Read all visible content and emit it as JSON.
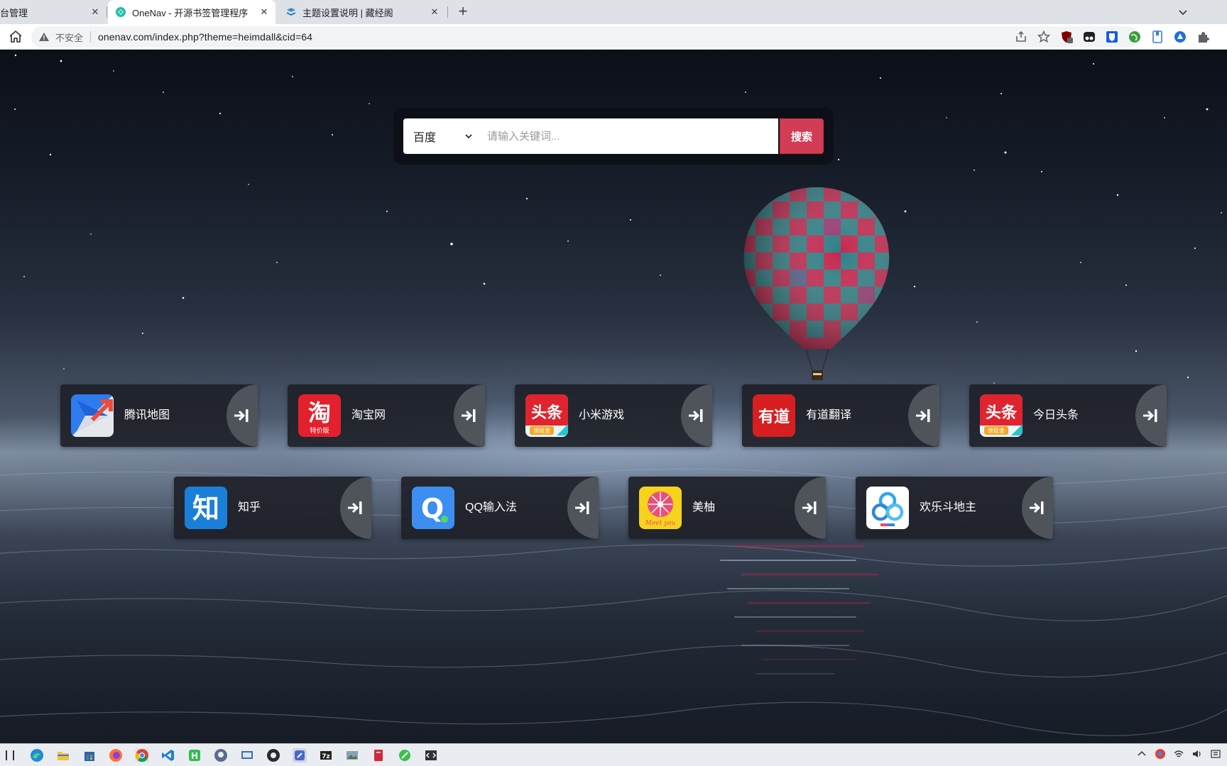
{
  "browser": {
    "tabs": [
      {
        "title": "后台管理",
        "active": false
      },
      {
        "title": "OneNav - 开源书签管理程序",
        "active": true
      },
      {
        "title": "主题设置说明 | 藏经阁",
        "active": false
      }
    ],
    "new_tab_symbol": "+",
    "close_symbol": "✕",
    "security_label": "不安全",
    "url": "onenav.com/index.php?theme=heimdall&cid=64"
  },
  "search": {
    "engine": "百度",
    "placeholder": "请输入关键词...",
    "button_label": "搜索"
  },
  "bookmarks": [
    {
      "label": "腾讯地图",
      "icon": "tencent-map-icon"
    },
    {
      "label": "淘宝网",
      "icon": "taobao-icon",
      "icon_text": "淘",
      "icon_sub": "特价版"
    },
    {
      "label": "小米游戏",
      "icon": "toutiao-icon",
      "icon_text": "头条",
      "icon_sub": "领现金"
    },
    {
      "label": "有道翻译",
      "icon": "youdao-icon",
      "icon_text": "有道"
    },
    {
      "label": "今日头条",
      "icon": "toutiao-icon",
      "icon_text": "头条",
      "icon_sub": "领现金"
    },
    {
      "label": "知乎",
      "icon": "zhihu-icon",
      "icon_text": "知"
    },
    {
      "label": "QQ输入法",
      "icon": "qq-input-icon",
      "icon_text": "Q"
    },
    {
      "label": "美柚",
      "icon": "meiyou-icon",
      "icon_text": "Meet you"
    },
    {
      "label": "欢乐斗地主",
      "icon": "doudizhu-icon"
    }
  ],
  "colors": {
    "search_button": "#d23c54",
    "card_background": "#1e2128",
    "taobao_red": "#e3202c",
    "zhihu_blue": "#1a7fd8",
    "qq_blue": "#3c8ef0",
    "meiyou_yellow": "#f7d31c",
    "meiyou_pink": "#ee4d7a"
  }
}
